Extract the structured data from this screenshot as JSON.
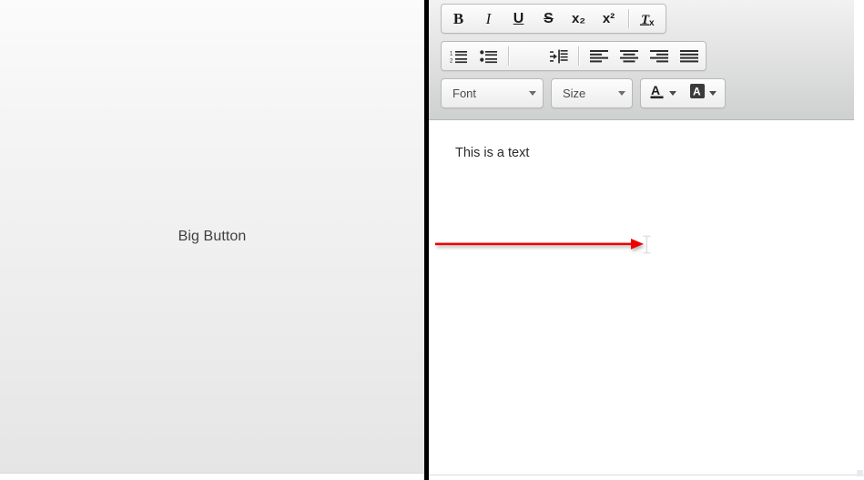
{
  "left_panel": {
    "button_label": "Big Button"
  },
  "editor": {
    "toolbar": {
      "row1": [
        {
          "name": "bold-icon",
          "label": "Bold",
          "glyph": "B"
        },
        {
          "name": "italic-icon",
          "label": "Italic",
          "glyph": "I"
        },
        {
          "name": "underline-icon",
          "label": "Underline",
          "glyph": "U"
        },
        {
          "name": "strikethrough-icon",
          "label": "Strikethrough",
          "glyph": "S"
        },
        {
          "name": "subscript-icon",
          "label": "Subscript",
          "glyph": "x₂"
        },
        {
          "name": "superscript-icon",
          "label": "Superscript",
          "glyph": "x²"
        },
        {
          "name": "separator",
          "label": "",
          "glyph": ""
        },
        {
          "name": "remove-format-icon",
          "label": "Remove Format",
          "glyph": "Tx"
        }
      ],
      "row2": [
        {
          "name": "numbered-list-icon",
          "label": "Insert/Remove Numbered List"
        },
        {
          "name": "bulleted-list-icon",
          "label": "Insert/Remove Bulleted List"
        },
        {
          "name": "separator",
          "label": ""
        },
        {
          "name": "increase-indent-icon",
          "label": "Increase Indent"
        },
        {
          "name": "separator",
          "label": ""
        },
        {
          "name": "align-left-icon",
          "label": "Align Left"
        },
        {
          "name": "align-center-icon",
          "label": "Center"
        },
        {
          "name": "align-right-icon",
          "label": "Align Right"
        },
        {
          "name": "justify-icon",
          "label": "Justify"
        }
      ],
      "row3": {
        "font_combo": {
          "label": "Font",
          "name": "font-dropdown"
        },
        "size_combo": {
          "label": "Size",
          "name": "size-dropdown"
        },
        "text_color": {
          "label": "Text Color",
          "name": "text-color-button",
          "glyph": "A"
        },
        "bg_color": {
          "label": "Background Color",
          "name": "background-color-button",
          "glyph": "A"
        }
      }
    },
    "content": {
      "text": "This is a text"
    }
  },
  "annotation": {
    "arrow": {
      "name": "red-arrow-annotation",
      "color": "#ee0000",
      "direction": "right"
    },
    "cursor": {
      "name": "text-ibeam-cursor",
      "color": "#e3e3e3"
    }
  },
  "colors": {
    "divider": "#000000",
    "toolbar_top": "#f2f2f2",
    "toolbar_bottom": "#cfd1d0",
    "panel_top": "#fbfbfb",
    "panel_bottom": "#e5e5e5",
    "accent_red": "#ee0000"
  }
}
